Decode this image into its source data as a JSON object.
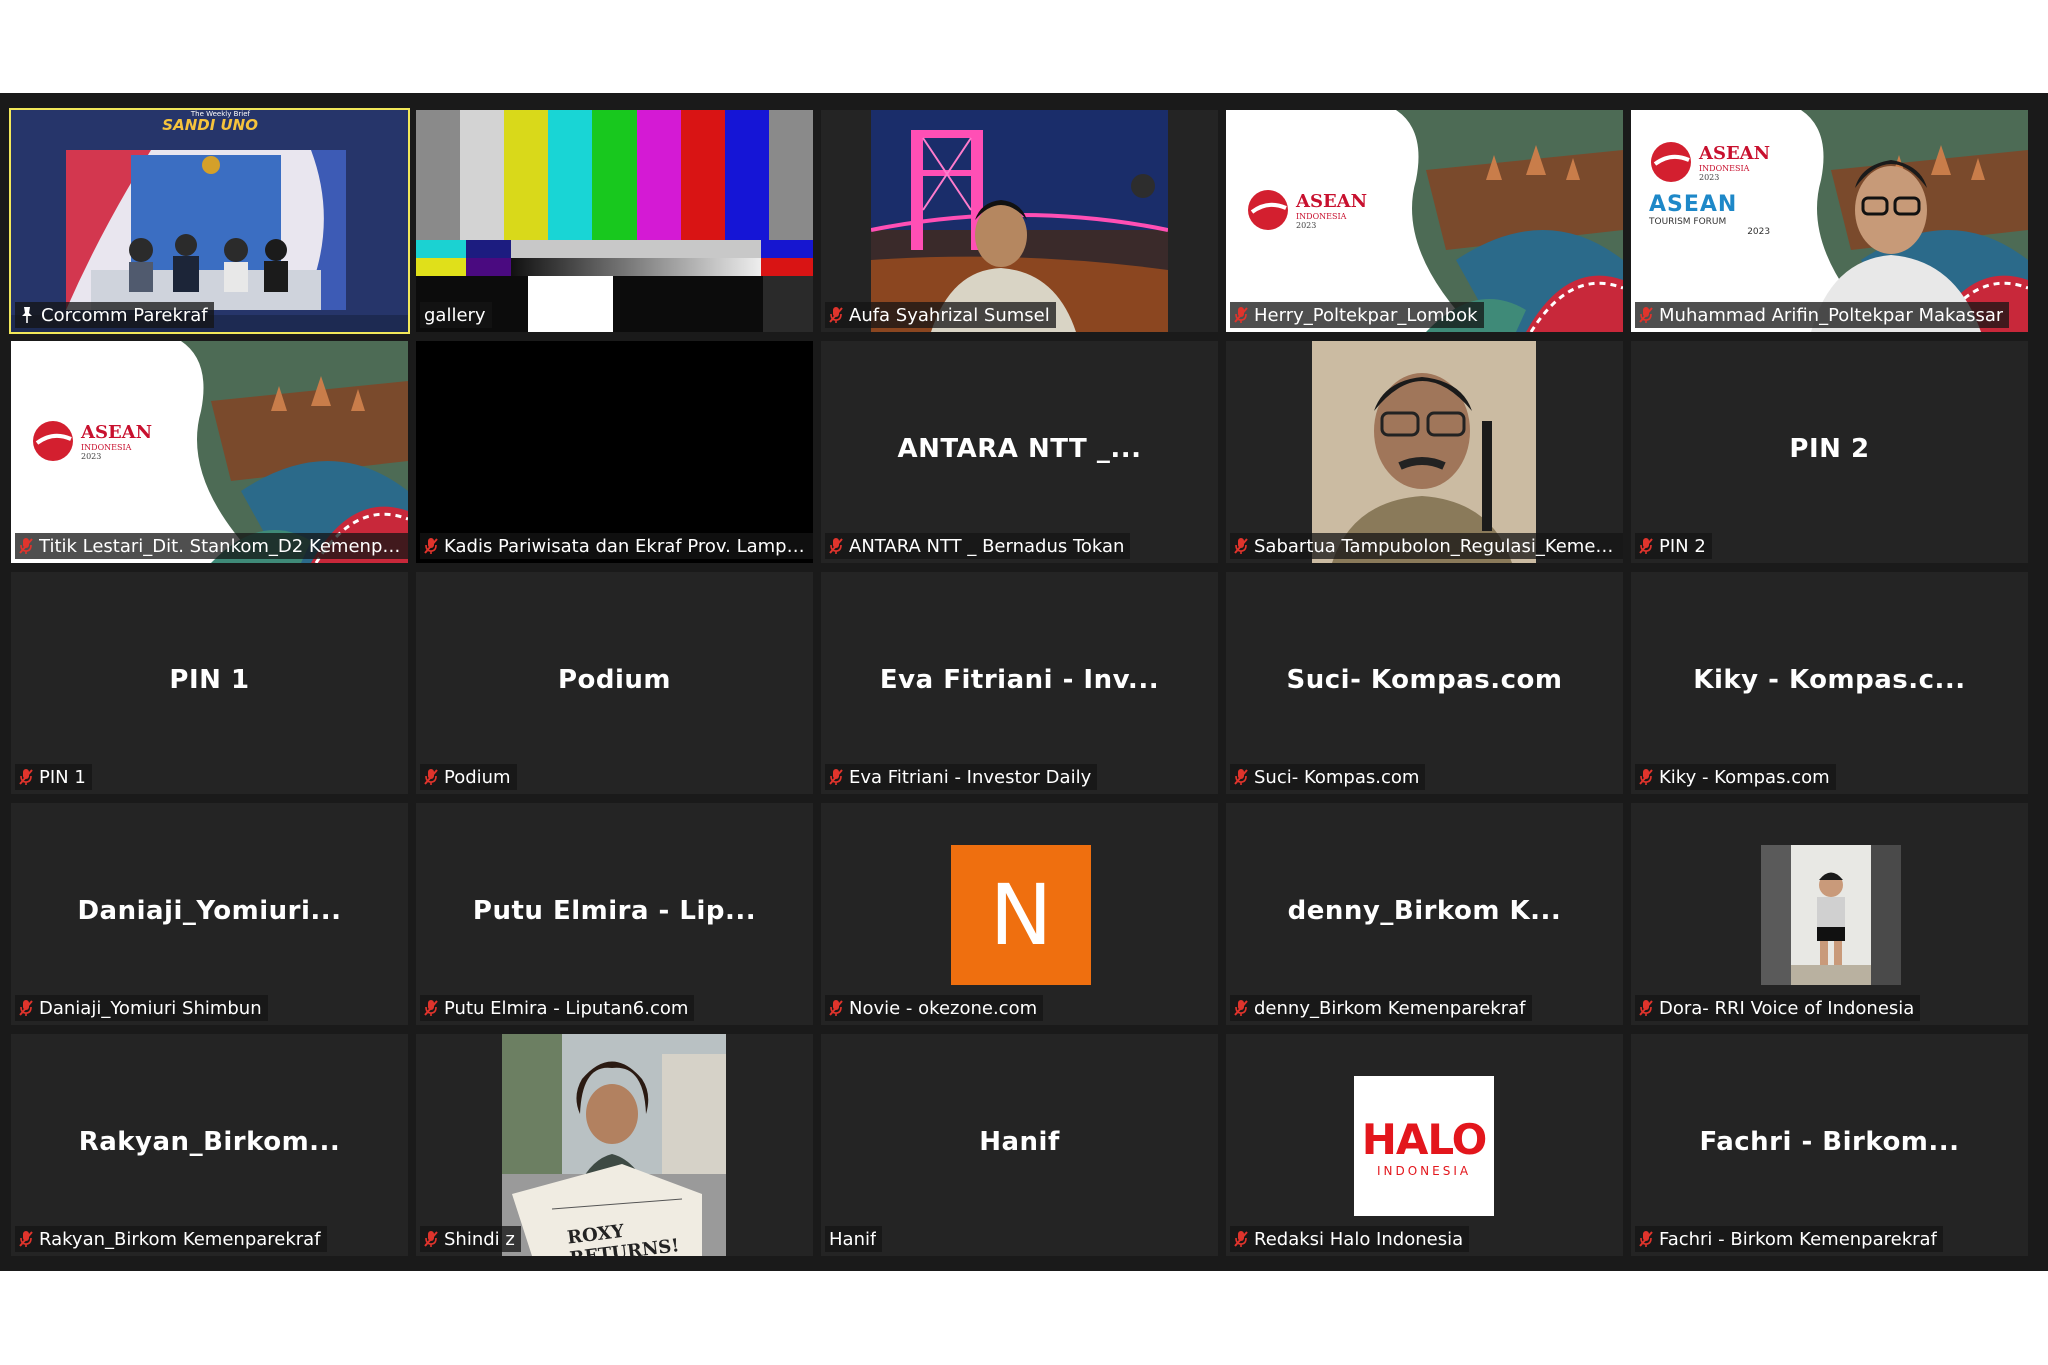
{
  "participants": [
    {
      "name": "Corcomm Parekraf",
      "display": "",
      "muted": false,
      "pinned": true,
      "active": true,
      "visual": "stage-screen"
    },
    {
      "name": "gallery",
      "display": "",
      "muted": false,
      "pinned": false,
      "active": false,
      "visual": "color-bars"
    },
    {
      "name": "Aufa Syahrizal Sumsel",
      "display": "",
      "muted": true,
      "pinned": false,
      "active": false,
      "visual": "bridge-camera"
    },
    {
      "name": "Herry_Poltekpar_Lombok",
      "display": "",
      "muted": true,
      "pinned": false,
      "active": false,
      "visual": "asean-banner"
    },
    {
      "name": "Muhammad Arifin_Poltekpar Makassar",
      "display": "",
      "muted": true,
      "pinned": false,
      "active": false,
      "visual": "asean-banner-person"
    },
    {
      "name": "Titik Lestari_Dit. Stankom_D2 Kemenpare...",
      "display": "",
      "muted": true,
      "pinned": false,
      "active": false,
      "visual": "asean-banner"
    },
    {
      "name": "Kadis Pariwisata dan Ekraf Prov. Lampung",
      "display": "",
      "muted": true,
      "pinned": false,
      "active": false,
      "visual": "black"
    },
    {
      "name": "ANTARA NTT _ Bernadus Tokan",
      "display": "ANTARA  NTT  _...",
      "muted": true,
      "pinned": false,
      "active": false,
      "visual": "name"
    },
    {
      "name": "Sabartua Tampubolon_Regulasi_Kemenp...",
      "display": "",
      "muted": true,
      "pinned": false,
      "active": false,
      "visual": "person-camera"
    },
    {
      "name": "PIN 2",
      "display": "PIN 2",
      "muted": true,
      "pinned": false,
      "active": false,
      "visual": "name"
    },
    {
      "name": "PIN 1",
      "display": "PIN 1",
      "muted": true,
      "pinned": false,
      "active": false,
      "visual": "name"
    },
    {
      "name": "Podium",
      "display": "Podium",
      "muted": true,
      "pinned": false,
      "active": false,
      "visual": "name"
    },
    {
      "name": "Eva Fitriani - Investor Daily",
      "display": "Eva Fitriani  -  Inv...",
      "muted": true,
      "pinned": false,
      "active": false,
      "visual": "name"
    },
    {
      "name": "Suci- Kompas.com",
      "display": "Suci- Kompas.com",
      "muted": true,
      "pinned": false,
      "active": false,
      "visual": "name"
    },
    {
      "name": "Kiky - Kompas.com",
      "display": "Kiky  -  Kompas.c...",
      "muted": true,
      "pinned": false,
      "active": false,
      "visual": "name"
    },
    {
      "name": "Daniaji_Yomiuri Shimbun",
      "display": "Daniaji_Yomiuri...",
      "muted": true,
      "pinned": false,
      "active": false,
      "visual": "name"
    },
    {
      "name": "Putu Elmira - Liputan6.com",
      "display": "Putu Elmira  -  Lip...",
      "muted": true,
      "pinned": false,
      "active": false,
      "visual": "name"
    },
    {
      "name": "Novie - okezone.com",
      "display": "",
      "muted": true,
      "pinned": false,
      "active": false,
      "visual": "avatar-letter",
      "avatar_letter": "N"
    },
    {
      "name": "denny_Birkom Kemenparekraf",
      "display": "denny_Birkom  K...",
      "muted": true,
      "pinned": false,
      "active": false,
      "visual": "name"
    },
    {
      "name": "Dora- RRI Voice of Indonesia",
      "display": "",
      "muted": true,
      "pinned": false,
      "active": false,
      "visual": "avatar-photo"
    },
    {
      "name": "Rakyan_Birkom Kemenparekraf",
      "display": "Rakyan_Birkom...",
      "muted": true,
      "pinned": false,
      "active": false,
      "visual": "name"
    },
    {
      "name": "Shindi z",
      "display": "",
      "muted": true,
      "pinned": false,
      "active": false,
      "visual": "newspaper-photo",
      "photo_text": "ROXY RETURNS!"
    },
    {
      "name": "Hanif",
      "display": "Hanif",
      "muted": false,
      "pinned": false,
      "active": false,
      "visual": "name"
    },
    {
      "name": "Redaksi Halo Indonesia",
      "display": "",
      "muted": true,
      "pinned": false,
      "active": false,
      "visual": "logo",
      "logo_text": "HALO",
      "logo_sub": "INDONESIA"
    },
    {
      "name": "Fachri - Birkom Kemenparekraf",
      "display": "Fachri  -  Birkom...",
      "muted": true,
      "pinned": false,
      "active": false,
      "visual": "name"
    }
  ],
  "banner": {
    "asean": "ASEAN",
    "indonesia": "INDONESIA",
    "year": "2023",
    "forum_line1": "TOURISM FORUM",
    "forum_year": "2023"
  },
  "stage": {
    "headline": "SANDI UNO",
    "subtitle": "The Weekly Brief"
  },
  "colors": {
    "grid_bg": "#1a1a1a",
    "tile_bg": "#242424",
    "active_border": "#f2e85a",
    "muted_icon": "#e0342c",
    "avatar_orange": "#ef6f0f"
  }
}
